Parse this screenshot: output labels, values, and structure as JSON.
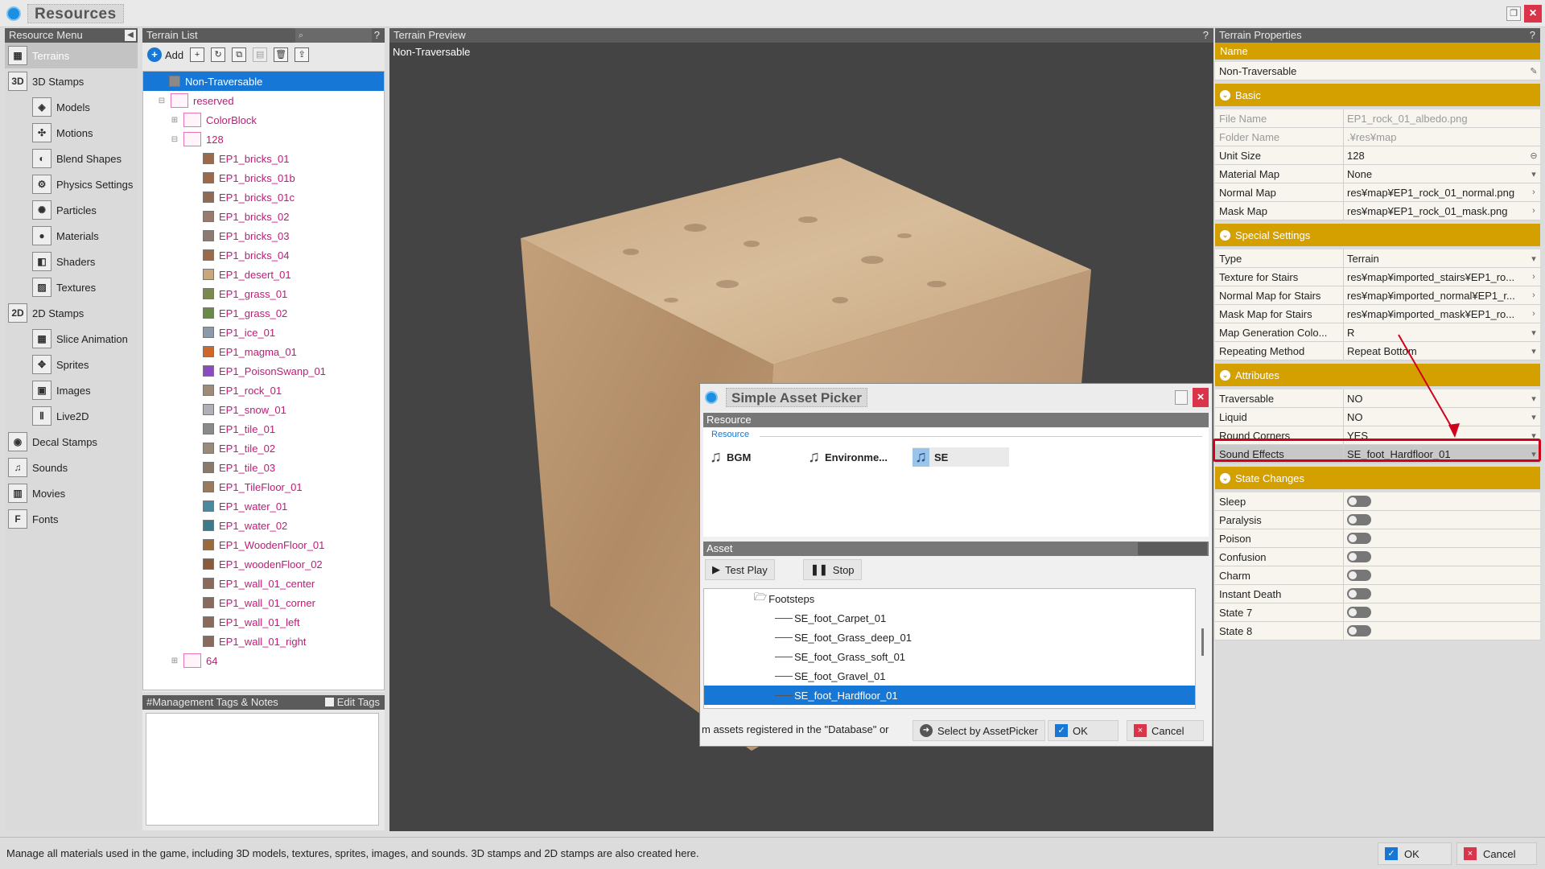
{
  "window": {
    "title": "Resources"
  },
  "resource_menu": {
    "header": "Resource Menu",
    "items": [
      {
        "label": "Terrains",
        "icon": "terrain-icon",
        "level": 0,
        "selected": true
      },
      {
        "label": "3D Stamps",
        "icon": "3d-stamp-icon",
        "level": 0
      },
      {
        "label": "Models",
        "icon": "model-icon",
        "level": 1
      },
      {
        "label": "Motions",
        "icon": "motion-icon",
        "level": 1
      },
      {
        "label": "Blend Shapes",
        "icon": "blend-shapes-icon",
        "level": 1
      },
      {
        "label": "Physics Settings",
        "icon": "physics-icon",
        "level": 1
      },
      {
        "label": "Particles",
        "icon": "particles-icon",
        "level": 1
      },
      {
        "label": "Materials",
        "icon": "materials-icon",
        "level": 1
      },
      {
        "label": "Shaders",
        "icon": "shaders-icon",
        "level": 1
      },
      {
        "label": "Textures",
        "icon": "textures-icon",
        "level": 1
      },
      {
        "label": "2D Stamps",
        "icon": "2d-stamp-icon",
        "level": 0
      },
      {
        "label": "Slice Animation",
        "icon": "slice-animation-icon",
        "level": 1
      },
      {
        "label": "Sprites",
        "icon": "sprites-icon",
        "level": 1
      },
      {
        "label": "Images",
        "icon": "images-icon",
        "level": 1
      },
      {
        "label": "Live2D",
        "icon": "live2d-icon",
        "level": 1
      },
      {
        "label": "Decal Stamps",
        "icon": "decal-icon",
        "level": 0
      },
      {
        "label": "Sounds",
        "icon": "sounds-icon",
        "level": 0
      },
      {
        "label": "Movies",
        "icon": "movies-icon",
        "level": 0
      },
      {
        "label": "Fonts",
        "icon": "fonts-icon",
        "level": 0
      }
    ]
  },
  "terrain_list": {
    "header": "Terrain List",
    "help": "?",
    "add_label": "Add",
    "nodes": [
      {
        "label": "Non-Traversable",
        "depth": 0,
        "type": "cube",
        "selected": true
      },
      {
        "label": "reserved",
        "depth": 0,
        "type": "folder",
        "expand": "⊟"
      },
      {
        "label": "ColorBlock",
        "depth": 1,
        "type": "folder",
        "expand": "⊞"
      },
      {
        "label": "128",
        "depth": 1,
        "type": "folder",
        "expand": "⊟"
      },
      {
        "label": "EP1_bricks_01",
        "depth": 2,
        "type": "cube",
        "color": "#9c6a4a"
      },
      {
        "label": "EP1_bricks_01b",
        "depth": 2,
        "type": "cube",
        "color": "#9c6a4a"
      },
      {
        "label": "EP1_bricks_01c",
        "depth": 2,
        "type": "cube",
        "color": "#8f6a55"
      },
      {
        "label": "EP1_bricks_02",
        "depth": 2,
        "type": "cube",
        "color": "#9a7a6a"
      },
      {
        "label": "EP1_bricks_03",
        "depth": 2,
        "type": "cube",
        "color": "#8a7a72"
      },
      {
        "label": "EP1_bricks_04",
        "depth": 2,
        "type": "cube",
        "color": "#9a6a4a"
      },
      {
        "label": "EP1_desert_01",
        "depth": 2,
        "type": "cube",
        "color": "#c9a77c"
      },
      {
        "label": "EP1_grass_01",
        "depth": 2,
        "type": "cube",
        "color": "#7a8a4a"
      },
      {
        "label": "EP1_grass_02",
        "depth": 2,
        "type": "cube",
        "color": "#6a8a4a"
      },
      {
        "label": "EP1_ice_01",
        "depth": 2,
        "type": "cube",
        "color": "#8a9aaa"
      },
      {
        "label": "EP1_magma_01",
        "depth": 2,
        "type": "cube",
        "color": "#d0662a"
      },
      {
        "label": "EP1_PoisonSwanp_01",
        "depth": 2,
        "type": "cube",
        "color": "#8a4ac0"
      },
      {
        "label": "EP1_rock_01",
        "depth": 2,
        "type": "cube",
        "color": "#a08a78"
      },
      {
        "label": "EP1_snow_01",
        "depth": 2,
        "type": "cube",
        "color": "#b0b0b8"
      },
      {
        "label": "EP1_tile_01",
        "depth": 2,
        "type": "cube",
        "color": "#8a8a8a"
      },
      {
        "label": "EP1_tile_02",
        "depth": 2,
        "type": "cube",
        "color": "#9a8a7a"
      },
      {
        "label": "EP1_tile_03",
        "depth": 2,
        "type": "cube",
        "color": "#8a7a6a"
      },
      {
        "label": "EP1_TileFloor_01",
        "depth": 2,
        "type": "cube",
        "color": "#9a7a5a"
      },
      {
        "label": "EP1_water_01",
        "depth": 2,
        "type": "cube",
        "color": "#4a8aa0"
      },
      {
        "label": "EP1_water_02",
        "depth": 2,
        "type": "cube",
        "color": "#3a7a8a"
      },
      {
        "label": "EP1_WoodenFloor_01",
        "depth": 2,
        "type": "cube",
        "color": "#9a6a3a"
      },
      {
        "label": "EP1_woodenFloor_02",
        "depth": 2,
        "type": "cube",
        "color": "#8a5a3a"
      },
      {
        "label": "EP1_wall_01_center",
        "depth": 2,
        "type": "cube",
        "color": "#8a6a5a"
      },
      {
        "label": "EP1_wall_01_corner",
        "depth": 2,
        "type": "cube",
        "color": "#8a6a5a"
      },
      {
        "label": "EP1_wall_01_left",
        "depth": 2,
        "type": "cube",
        "color": "#8a6a5a"
      },
      {
        "label": "EP1_wall_01_right",
        "depth": 2,
        "type": "cube",
        "color": "#8a6a5a"
      },
      {
        "label": "64",
        "depth": 1,
        "type": "folder",
        "expand": "⊞"
      }
    ]
  },
  "tags": {
    "header": "#Management Tags & Notes",
    "edit_label": "Edit Tags"
  },
  "preview": {
    "header": "Terrain Preview",
    "help": "?",
    "label": "Non-Traversable"
  },
  "properties": {
    "header": "Terrain Properties",
    "help": "?",
    "name_section": "Name",
    "name_value": "Non-Traversable",
    "sections": {
      "basic": "Basic",
      "special": "Special Settings",
      "attributes": "Attributes",
      "state": "State Changes"
    },
    "basic_rows": [
      {
        "key": "File Name",
        "value": "EP1_rock_01_albedo.png",
        "dim": true
      },
      {
        "key": "Folder Name",
        "value": ".¥res¥map",
        "dim": true
      },
      {
        "key": "Unit Size",
        "value": "128",
        "end": "⊖"
      },
      {
        "key": "Material Map",
        "value": "None",
        "end": "▾"
      },
      {
        "key": "Normal Map",
        "value": "res¥map¥EP1_rock_01_normal.png",
        "end": "›"
      },
      {
        "key": "Mask Map",
        "value": "res¥map¥EP1_rock_01_mask.png",
        "end": "›"
      }
    ],
    "special_rows": [
      {
        "key": "Type",
        "value": "Terrain",
        "end": "▾"
      },
      {
        "key": "Texture for Stairs",
        "value": "res¥map¥imported_stairs¥EP1_ro...",
        "end": "›"
      },
      {
        "key": "Normal Map for Stairs",
        "value": "res¥map¥imported_normal¥EP1_r...",
        "end": "›"
      },
      {
        "key": "Mask Map for Stairs",
        "value": "res¥map¥imported_mask¥EP1_ro...",
        "end": "›"
      },
      {
        "key": "Map Generation Colo...",
        "value": "R",
        "end": "▾"
      },
      {
        "key": "Repeating Method",
        "value": "Repeat Bottom",
        "end": "▾"
      }
    ],
    "attribute_rows": [
      {
        "key": "Traversable",
        "value": "NO",
        "end": "▾"
      },
      {
        "key": "Liquid",
        "value": "NO",
        "end": "▾"
      },
      {
        "key": "Round Corners",
        "value": "YES",
        "end": "▾"
      },
      {
        "key": "Sound Effects",
        "value": "SE_foot_Hardfloor_01",
        "end": "▾",
        "highlight": true
      }
    ],
    "state_rows": [
      {
        "key": "Sleep"
      },
      {
        "key": "Paralysis"
      },
      {
        "key": "Poison"
      },
      {
        "key": "Confusion"
      },
      {
        "key": "Charm"
      },
      {
        "key": "Instant Death"
      },
      {
        "key": "State 7"
      },
      {
        "key": "State 8"
      }
    ]
  },
  "dialog": {
    "title": "Simple Asset Picker",
    "resource_header": "Resource",
    "resource_sub": "Resource",
    "tabs": [
      {
        "label": "BGM",
        "selected": false
      },
      {
        "label": "Environme...",
        "selected": false
      },
      {
        "label": "SE",
        "selected": true
      }
    ],
    "asset_header": "Asset",
    "test_play": "Test Play",
    "stop": "Stop",
    "tree": [
      {
        "label": "Footsteps",
        "folder": true
      },
      {
        "label": "SE_foot_Carpet_01"
      },
      {
        "label": "SE_foot_Grass_deep_01"
      },
      {
        "label": "SE_foot_Grass_soft_01"
      },
      {
        "label": "SE_foot_Gravel_01"
      },
      {
        "label": "SE_foot_Hardfloor_01",
        "selected": true
      }
    ],
    "hint": "m assets registered in the \"Database\" or",
    "select_by_picker": "Select by AssetPicker",
    "ok": "OK",
    "cancel": "Cancel"
  },
  "status": {
    "text": "Manage all materials used in the game, including 3D models, textures, sprites, images, and sounds. 3D stamps and 2D stamps are also created here.",
    "ok": "OK",
    "cancel": "Cancel"
  },
  "colors": {
    "accent": "#1677d6",
    "section": "#d4a000",
    "highlight": "#d0021b",
    "tree_text": "#c2187a"
  }
}
